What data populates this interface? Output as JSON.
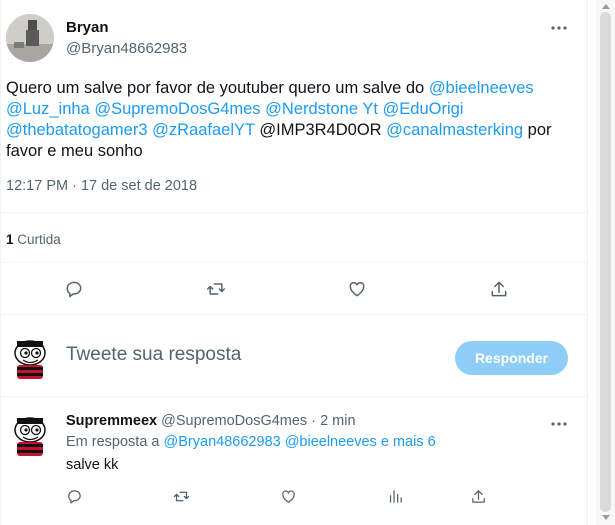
{
  "tweet": {
    "author_name": "Bryan",
    "author_handle": "@Bryan48662983",
    "more_icon": "more-horizontal-icon",
    "text_plain_1": "Quero um salve por favor de youtuber quero um salve do ",
    "mention_1": "@bieelneeves",
    "mention_2": "@Luz_inha",
    "mention_3": "@SupremoDosG4mes",
    "mention_4": "@Nerdstone Yt",
    "mention_5": "@EduOrigi",
    "mention_6": "@thebatatogamer3",
    "mention_7": "@zRaafaelYT",
    "text_plain_2": "@IMP3R4D0OR",
    "mention_8": "@canalmasterking",
    "text_plain_3": " por favor e meu sonho",
    "timestamp": "12:17 PM · 17 de set de 2018",
    "retweet_count": "1",
    "retweet_label": "Curtida"
  },
  "actions": {
    "reply_icon": "reply-icon",
    "retweet_icon": "retweet-icon",
    "like_icon": "like-icon",
    "share_icon": "share-icon"
  },
  "composer": {
    "placeholder": "Tweete sua resposta",
    "button_label": "Responder"
  },
  "reply": {
    "author_name": "Supremmeex",
    "author_handle": "@SupremoDosG4mes",
    "time": "· 2 min",
    "in_reply_prefix": "Em resposta a",
    "in_reply_mention_1": "@Bryan48662983",
    "in_reply_mention_2": "@bieelneeves e mais 6",
    "text": "salve kk"
  },
  "colors": {
    "accent": "#1d9bf0",
    "muted": "#536471",
    "button_disabled": "#8ecdf8"
  }
}
